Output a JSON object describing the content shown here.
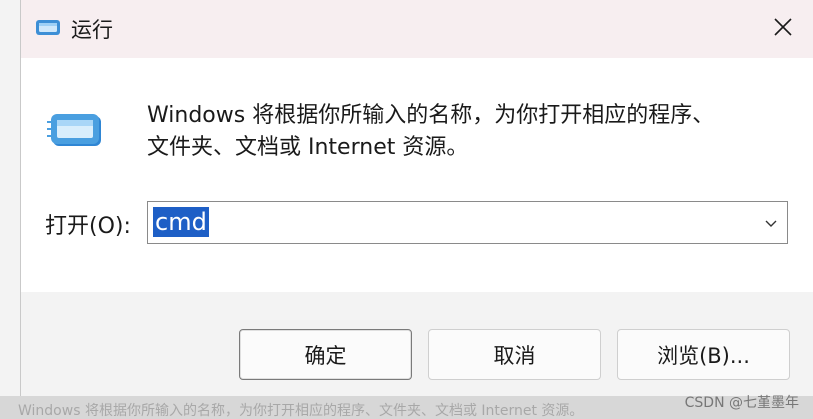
{
  "window": {
    "title": "运行",
    "close_label": "×"
  },
  "content": {
    "description_line1": "Windows 将根据你所输入的名称，为你打开相应的程序、",
    "description_line2": "文件夹、文档或 Internet 资源。",
    "open_label": "打开(O):",
    "input_value": "cmd"
  },
  "buttons": {
    "ok": "确定",
    "cancel": "取消",
    "browse": "浏览(B)..."
  },
  "background": {
    "ghost_text": "Windows 将根据你所输入的名称，为你打开相应的程序、文件夹、文档或 Internet 资源。"
  },
  "watermark": "CSDN @七堇墨年",
  "colors": {
    "title_bar": "#f7eef0",
    "selection": "#1e5fc6",
    "footer": "#f3f3f3",
    "icon_blue": "#4a9fe0"
  },
  "icons": {
    "title_icon": "run-icon",
    "content_icon": "run-icon",
    "close_icon": "close-icon",
    "dropdown_icon": "chevron-down-icon"
  }
}
